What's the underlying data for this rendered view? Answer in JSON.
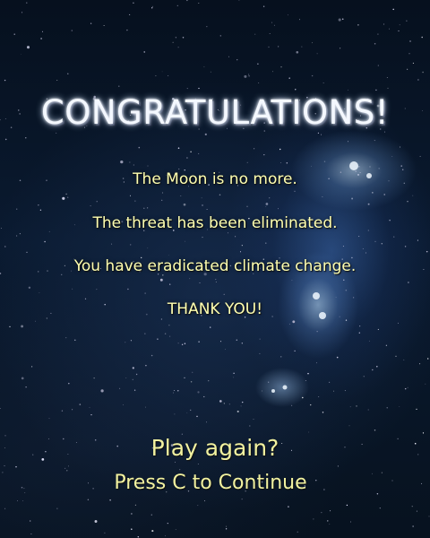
{
  "end_screen": {
    "title": "CONGRATULATIONS!",
    "messages": [
      "The Moon is no more.",
      "The threat has been eliminated.",
      "You have eradicated climate change.",
      "THANK YOU!"
    ],
    "prompt": "Play again?",
    "continue_hint": "Press C to Continue"
  },
  "colors": {
    "title_text": "#f4f8ff",
    "message_text": "#ffffb0",
    "prompt_text": "#f2f2a0",
    "background": "#0a1a30"
  }
}
